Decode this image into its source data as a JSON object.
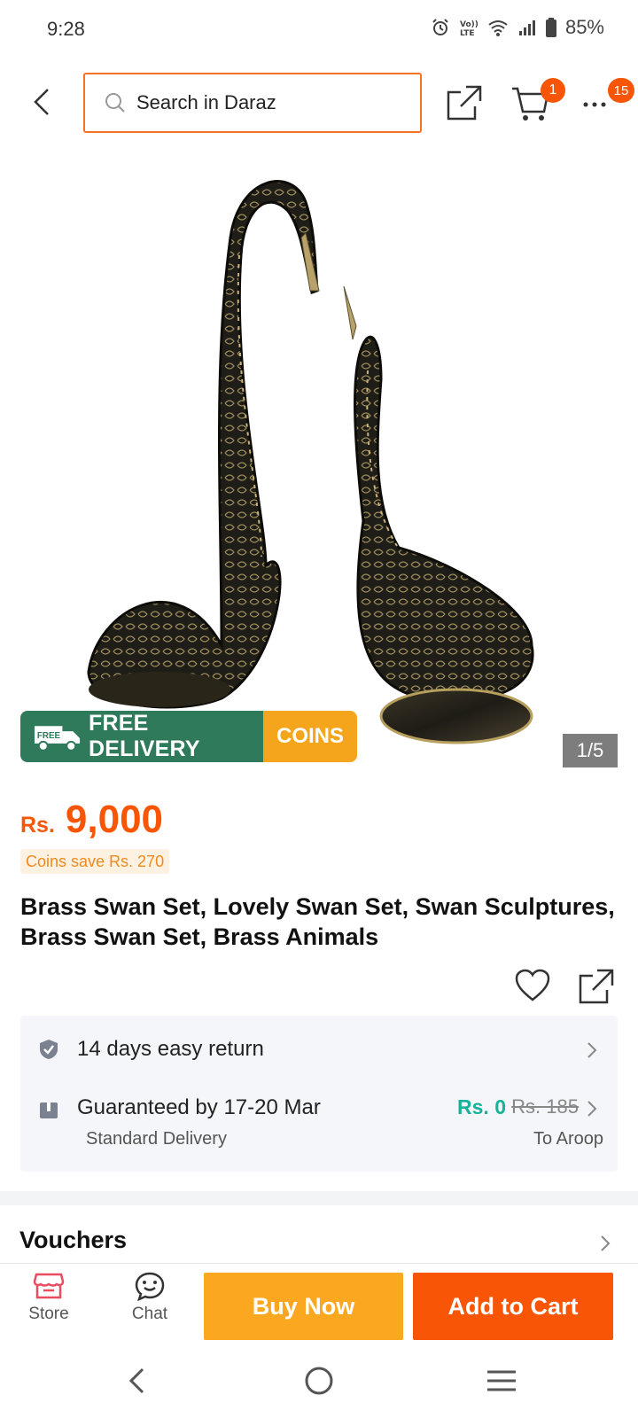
{
  "status_bar": {
    "time": "9:28",
    "battery": "85%",
    "icons": [
      "alarm-icon",
      "volte-icon",
      "wifi-icon",
      "signal-icon",
      "battery-icon"
    ]
  },
  "header": {
    "search_placeholder": "Search in Daraz",
    "cart_count": "1",
    "more_count": "15",
    "accent_color": "#f57224"
  },
  "product": {
    "image_counter": "1/5",
    "delivery_banner": {
      "free_badge": "FREE",
      "free_text": "FREE DELIVERY",
      "coins_text": "COINS"
    },
    "price_currency": "Rs.",
    "price_value": "9,000",
    "coins_save": "Coins save Rs. 270",
    "title": "Brass Swan Set, Lovely Swan Set, Swan Sculptures, Brass Swan Set, Brass Animals"
  },
  "services": {
    "return_text": "14 days easy return",
    "delivery_text": "Guaranteed by 17-20 Mar",
    "delivery_sub": "Standard Delivery",
    "delivery_price": "Rs. 0",
    "delivery_old_price": "Rs. 185",
    "delivery_to": "To Aroop"
  },
  "vouchers": {
    "title": "Vouchers"
  },
  "bottom_bar": {
    "store_label": "Store",
    "chat_label": "Chat",
    "buy_now_label": "Buy Now",
    "add_cart_label": "Add to Cart"
  },
  "colors": {
    "brand_orange": "#f85606",
    "buy_now": "#fca720",
    "free_green": "#2f7a5a",
    "coins_yellow": "#f4a51c",
    "teal_price": "#16b39a"
  }
}
